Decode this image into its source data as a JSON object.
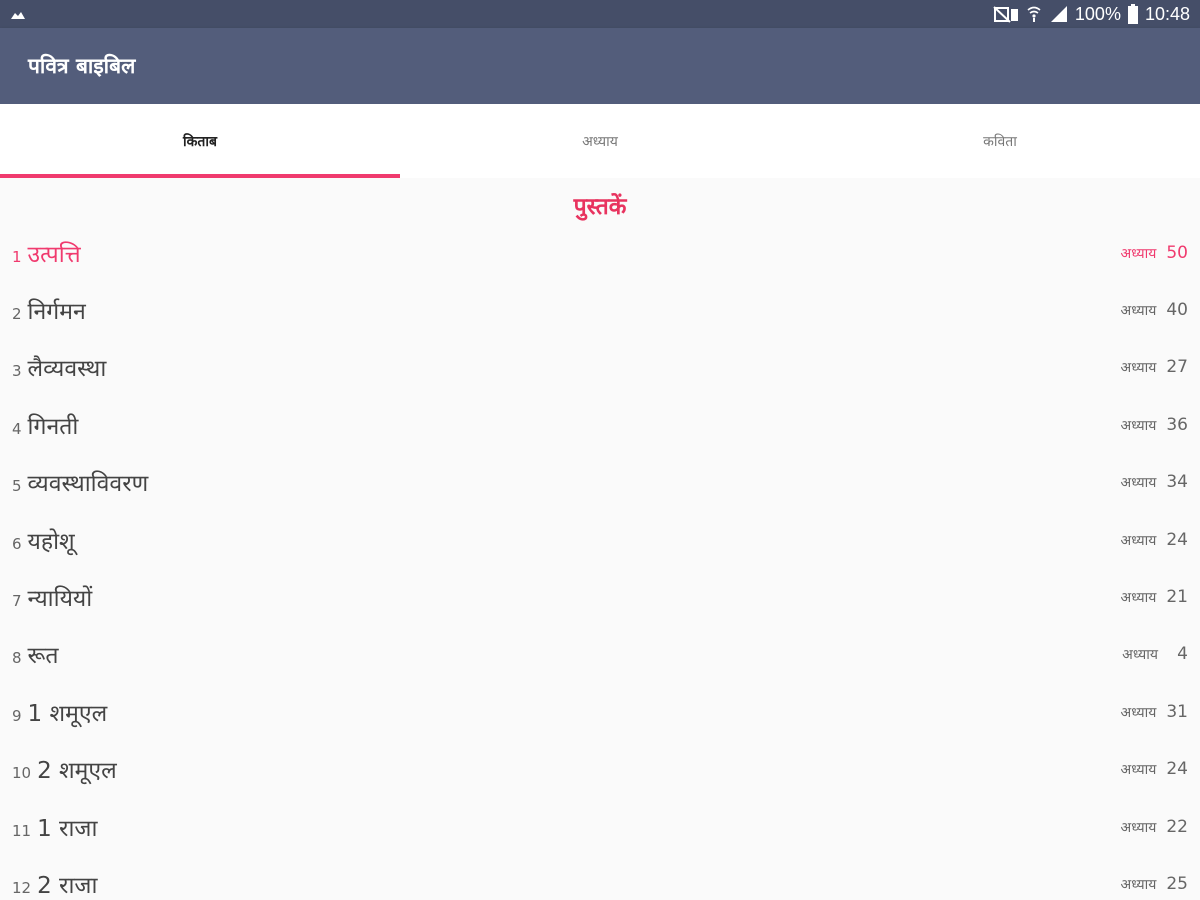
{
  "status_bar": {
    "battery": "100%",
    "time": "10:48",
    "icons": [
      "image-icon",
      "no-sim-icon",
      "wifi-icon",
      "signal-icon",
      "battery-icon"
    ]
  },
  "app_bar": {
    "title": "पवित्र बाइबिल"
  },
  "tabs": [
    {
      "label": "किताब",
      "active": true
    },
    {
      "label": "अध्याय",
      "active": false
    },
    {
      "label": "कविता",
      "active": false
    }
  ],
  "section_title": "पुस्तकें",
  "chapter_label": "अध्याय",
  "accent_color": "#f03a6e",
  "books": [
    {
      "num": "1",
      "name": "उत्पत्ति",
      "chapters": "50",
      "selected": true
    },
    {
      "num": "2",
      "name": "निर्गमन",
      "chapters": "40"
    },
    {
      "num": "3",
      "name": "लैव्यवस्था",
      "chapters": "27"
    },
    {
      "num": "4",
      "name": "गिनती",
      "chapters": "36"
    },
    {
      "num": "5",
      "name": "व्यवस्थाविवरण",
      "chapters": "34"
    },
    {
      "num": "6",
      "name": "यहोशू",
      "chapters": "24"
    },
    {
      "num": "7",
      "name": "न्यायियों",
      "chapters": "21"
    },
    {
      "num": "8",
      "name": "रूत",
      "chapters": "4"
    },
    {
      "num": "9",
      "name": "1 शमूएल",
      "chapters": "31"
    },
    {
      "num": "10",
      "name": "2 शमूएल",
      "chapters": "24"
    },
    {
      "num": "11",
      "name": "1 राजा",
      "chapters": "22"
    },
    {
      "num": "12",
      "name": "2 राजा",
      "chapters": "25"
    }
  ]
}
